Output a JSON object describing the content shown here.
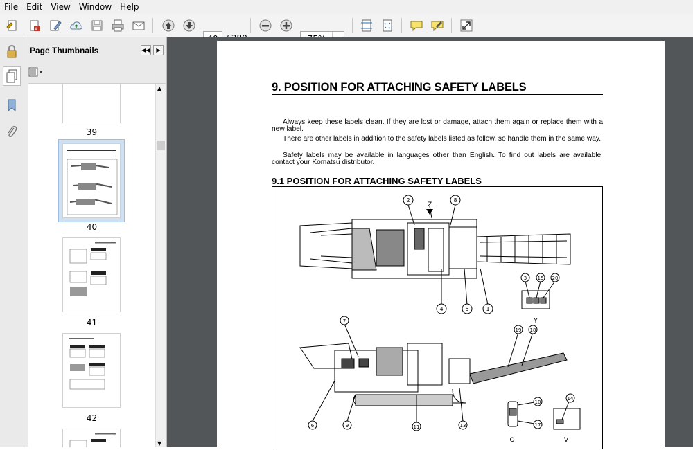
{
  "menu": [
    "File",
    "Edit",
    "View",
    "Window",
    "Help"
  ],
  "toolbar": {
    "current_page": "40",
    "total_pages": "/ 280",
    "zoom": "75%"
  },
  "panel": {
    "title": "Page Thumbnails"
  },
  "thumbnails": [
    {
      "page": "39"
    },
    {
      "page": "40",
      "selected": true
    },
    {
      "page": "41"
    },
    {
      "page": "42"
    }
  ],
  "document": {
    "heading": "9. POSITION FOR ATTACHING SAFETY LABELS",
    "paragraphs": [
      "Always keep these labels clean. If they are lost or damage, attach them again or replace them with a new label.",
      "There are other labels in addition to the safety labels listed as follow, so handle them in the same way.",
      "Safety labels may be available in languages other than English. To find out labels are available, contact your Komatsu distributor."
    ],
    "subheading": "9.1  POSITION FOR ATTACHING SAFETY LABELS",
    "figure_labels": {
      "z": "Z",
      "y": "Y",
      "q": "Q",
      "v": "V",
      "callouts": [
        "2",
        "8",
        "4",
        "5",
        "1",
        "3",
        "15",
        "20",
        "7",
        "19",
        "18",
        "6",
        "9",
        "11",
        "13",
        "10",
        "17",
        "14"
      ]
    }
  }
}
